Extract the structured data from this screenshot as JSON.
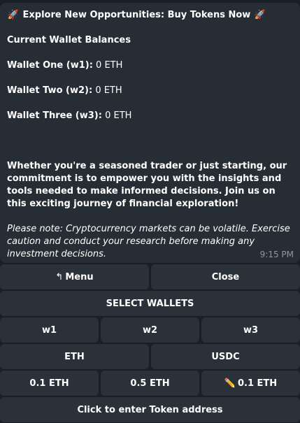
{
  "message": {
    "title_icon_left": "rocket-icon",
    "title": "Explore New Opportunities: Buy Tokens Now",
    "title_icon_right": "rocket-icon",
    "balances_heading": "Current Wallet Balances",
    "wallets": [
      {
        "label": "Wallet One (w1):",
        "value": "0 ETH"
      },
      {
        "label": "Wallet Two (w2):",
        "value": "0 ETH"
      },
      {
        "label": "Wallet Three (w3):",
        "value": "0 ETH"
      }
    ],
    "body": "Whether you're a seasoned trader or just starting, our commitment is to empower you with the insights and tools needed to make informed decisions. Join us on this exciting journey of financial exploration!",
    "note": "Please note: Cryptocurrency markets can be volatile. Exercise caution and conduct your research before making any investment decisions.",
    "time": "9:15 PM"
  },
  "keyboard": {
    "menu": "Menu",
    "menu_icon": "↰",
    "close": "Close",
    "select_wallets": "SELECT WALLETS",
    "w1": "w1",
    "w2": "w2",
    "w3": "w3",
    "eth": "ETH",
    "usdc": "USDC",
    "amount_1": "0.1 ETH",
    "amount_2": "0.5 ETH",
    "amount_3": "0.1 ETH",
    "amount_3_icon": "✏️",
    "token_address": "Click to enter Token address"
  },
  "colors": {
    "bubble": "#262d35",
    "button": "#2b3138",
    "timestamp": "#8e98a3"
  }
}
